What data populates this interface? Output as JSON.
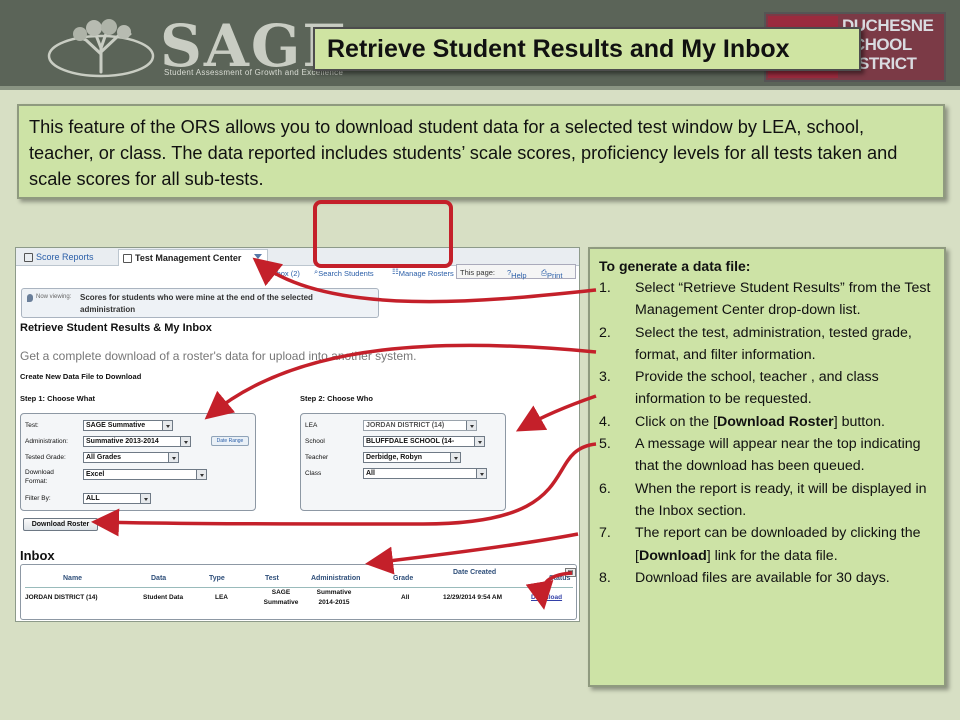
{
  "header": {
    "sage_logo": {
      "word": "SAGE",
      "subtitle": "Student Assessment of Growth and Excellence"
    },
    "district_logo": {
      "lines": [
        "DUCHESNE",
        "SCHOOL",
        "DISTRICT"
      ]
    },
    "slide_title": "Retrieve Student Results and My Inbox"
  },
  "intro": {
    "text": "This feature of the ORS allows you to download student data for a selected test window by LEA, school, teacher, or class.  The data reported includes students’ scale scores, proficiency levels for all tests taken and scale scores for all sub-tests."
  },
  "screenshot": {
    "tabs": {
      "score_reports": "Score Reports",
      "test_management": "Test Management Center"
    },
    "toolbar": {
      "inbox": "Inbox (2)",
      "search_students": "Search Students",
      "manage_rosters": "Manage Rosters"
    },
    "this_page": {
      "label": "This page:",
      "help": "Help",
      "print": "Print"
    },
    "now_viewing": {
      "label": "Now viewing:",
      "text": "Scores for students who were mine at the end of the selected administration"
    },
    "page_title": "Retrieve Student Results & My Inbox",
    "description": "Get a complete download of a roster's data for upload into another system.",
    "create_new": "Create New Data File to Download",
    "step1": {
      "title": "Step 1: Choose What",
      "test_label": "Test:",
      "test_value": "SAGE Summative",
      "admin_label": "Administration:",
      "admin_value": "Summative 2013-2014",
      "date_range": "Date Range",
      "grade_label": "Tested Grade:",
      "grade_value": "All Grades",
      "format_label_1": "Download",
      "format_label_2": "Format:",
      "format_value": "Excel",
      "filter_label": "Filter By:",
      "filter_value": "ALL"
    },
    "step2": {
      "title": "Step 2: Choose Who",
      "lea_label": "LEA",
      "lea_value": "JORDAN DISTRICT (14)",
      "school_label": "School",
      "school_value": "BLUFFDALE SCHOOL (14-",
      "teacher_label": "Teacher",
      "teacher_value": "Derbidge, Robyn",
      "class_label": "Class",
      "class_value": "All"
    },
    "download_roster_button": "Download Roster",
    "inbox": {
      "title": "Inbox",
      "columns": [
        "Name",
        "Data",
        "Type",
        "Test",
        "Administration",
        "Grade",
        "Date Created",
        "Status"
      ],
      "row": {
        "name": "JORDAN DISTRICT (14)",
        "data": "Student Data",
        "type": "LEA",
        "test_1": "SAGE",
        "test_2": "Summative",
        "admin_1": "Summative",
        "admin_2": "2014-2015",
        "grade": "All",
        "date": "12/29/2014 9:54 AM",
        "status": "Download"
      }
    }
  },
  "steps_panel": {
    "heading": "To generate a data file:",
    "items": [
      {
        "num": "1.",
        "text": "Select “Retrieve Student Results” from the Test Management Center drop-down list."
      },
      {
        "num": "2.",
        "text": "Select the test, administration, tested grade, format, and filter information."
      },
      {
        "num": "3.",
        "text": "Provide the school, teacher , and class information to be requested."
      },
      {
        "num": "4.",
        "pre": "Click on the [",
        "bold": "Download Roster",
        "post": "] button."
      },
      {
        "num": "5.",
        "text": "A message will appear near the top indicating that the download has been queued."
      },
      {
        "num": "6.",
        "text": "When the report is ready, it will be displayed in the Inbox section."
      },
      {
        "num": "7.",
        "pre": "The report can be downloaded by clicking the [",
        "bold": "Download",
        "post": "] link for the data file."
      },
      {
        "num": "8.",
        "text": "Download files are available for 30 days."
      }
    ]
  },
  "colors": {
    "banner": "#5b6458",
    "panel_green": "#cde3a6",
    "page_bg": "#d7dfc4",
    "arrow_red": "#c4202a"
  }
}
